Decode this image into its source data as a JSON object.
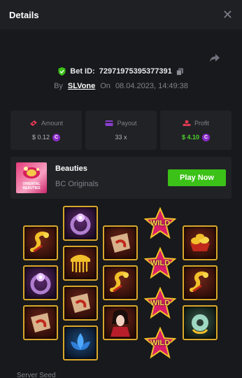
{
  "header": {
    "title": "Details",
    "close_icon": "close-icon"
  },
  "bet": {
    "id_label": "Bet ID:",
    "id_value": "72971975395377391",
    "by_label": "By",
    "user": "SLVone",
    "on_label": "On",
    "datetime": "08.04.2023, 14:49:38"
  },
  "stats": {
    "amount_label": "Amount",
    "amount_value": "$ 0.12",
    "payout_label": "Payout",
    "payout_value": "33 x",
    "profit_label": "Profit",
    "profit_value": "$ 4.10",
    "currency_glyph": "C"
  },
  "game": {
    "name": "Beauties",
    "provider": "BC Originals",
    "thumb_text": "ORIENTAL BEAUTIES",
    "play_label": "Play Now"
  },
  "reels": {
    "wild_text": "WILD"
  },
  "footer": {
    "label": "Server Seed"
  },
  "colors": {
    "accent_green": "#3bc117",
    "gold": "#d9a72a",
    "coin": "#8a2cc9"
  }
}
